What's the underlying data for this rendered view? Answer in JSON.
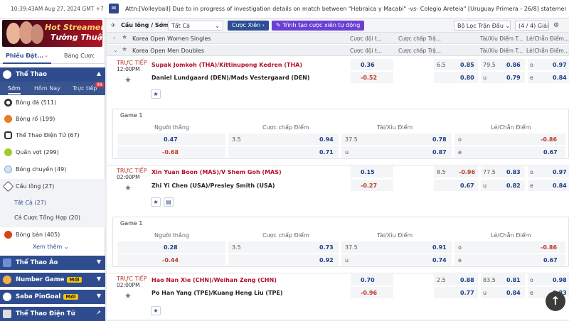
{
  "topbar": {
    "time": "10:39:43AM Aug 27, 2024 GMT +7",
    "ticker": "Attn:[Volleyball] Due to in progress of investigation details on match between \"Hebraica y Macabi\" -vs- Colegio Areteia\" [Uruguay Primera - 26/8] statement will be mov"
  },
  "sidebar": {
    "banner": {
      "line1": "Hot Streamer",
      "line2": "Tướng Thuật"
    },
    "tabs": [
      "Phiếu Đặt...",
      "Bảng Cược"
    ],
    "sports_header": "Thể Thao",
    "subtabs": [
      "Sớm",
      "Hôm Nay",
      "Trực tiếp"
    ],
    "live_count": "98",
    "sports": [
      {
        "label": "Bóng đá",
        "count": "(511)"
      },
      {
        "label": "Bóng rổ",
        "count": "(199)"
      },
      {
        "label": "Thể Thao Điện Tử",
        "count": "(67)"
      },
      {
        "label": "Quần vợt",
        "count": "(299)"
      },
      {
        "label": "Bóng chuyền",
        "count": "(49)"
      },
      {
        "label": "Cầu lông",
        "count": "(27)"
      }
    ],
    "sub_items": [
      {
        "label": "Tất Cả",
        "count": "(27)"
      },
      {
        "label": "Cá Cược Tổng Hợp",
        "count": "(20)"
      }
    ],
    "sport_table_tennis": {
      "label": "Bóng bàn",
      "count": "(405)"
    },
    "more": "Xem thêm",
    "virtual": "Thể Thao Ảo",
    "number_game": "Number Game",
    "pingoal": "Saba PinGoal",
    "new_badge": "Mới",
    "esports": "Thể Thao Điện Tử"
  },
  "filter": {
    "title": "Cầu lông / Sớm",
    "select_all": "Tất Cả",
    "parlay": "Cược Xiên",
    "creator": "Trình tạo cược xiên tự động",
    "match_filter": "Bộ Lọc Trận Đấu",
    "count": "(4 / 4) Giải"
  },
  "leagues": [
    {
      "name": "Korea Open Women Singles",
      "cols": [
        "Cược đội t...",
        "Cược chấp Trậ...",
        "Tài/Xỉu Điểm T...",
        "Lẻ/Chẵn Điểm..."
      ]
    },
    {
      "name": "Korea Open Men Doubles",
      "cols": [
        "Cược đội t...",
        "Cược chấp Trậ...",
        "Tài/Xỉu Điểm T...",
        "Lẻ/Chẵn Điểm..."
      ]
    }
  ],
  "live_label": "TRỰC TIẾP",
  "game_label": "Game 1",
  "game_cols": [
    "Người thắng",
    "Cược chấp Điểm",
    "Tài/Xỉu Điểm",
    "Lẻ/Chẵn Điểm"
  ],
  "matches": [
    {
      "time": "12:00PM",
      "home": "Supak Jomkoh (THA)/Kittinupong Kedren (THA)",
      "away": "Daniel Lundgaard (DEN)/Mads Vestergaard (DEN)",
      "ml": [
        "0.36",
        "-0.52"
      ],
      "hdp": [
        "6.5",
        "0.85",
        "",
        "0.80"
      ],
      "ou": [
        "79.5",
        "0.86",
        "u",
        "0.79"
      ],
      "oe": [
        "o",
        "0.97",
        "e",
        "0.84"
      ],
      "game": {
        "ml": [
          "0.47",
          "-0.68"
        ],
        "hdp": [
          "3.5",
          "0.94",
          "",
          "0.71"
        ],
        "ou": [
          "37.5",
          "0.78",
          "u",
          "0.87"
        ],
        "oe": [
          "o",
          "-0.86",
          "e",
          "0.67"
        ]
      }
    },
    {
      "time": "02:00PM",
      "home": "Xin Yuan Boon (MAS)/V Shem Goh (MAS)",
      "away": "Zhi Yi Chen (USA)/Presley Smith (USA)",
      "ml": [
        "0.15",
        "-0.27"
      ],
      "hdp": [
        "8.5",
        "-0.96",
        "",
        "0.67"
      ],
      "ou": [
        "77.5",
        "0.83",
        "u",
        "0.82"
      ],
      "oe": [
        "o",
        "0.97",
        "e",
        "0.84"
      ],
      "game": {
        "ml": [
          "0.28",
          "-0.44"
        ],
        "hdp": [
          "3.5",
          "0.73",
          "",
          "0.92"
        ],
        "ou": [
          "37.5",
          "0.91",
          "u",
          "0.74"
        ],
        "oe": [
          "o",
          "-0.86",
          "e",
          "0.67"
        ]
      }
    },
    {
      "time": "02:00PM",
      "home": "Hao Nan Xie (CHN)/Weihan Zeng (CHN)",
      "away": "Po Han Yang (TPE)/Kuang Heng Liu (TPE)",
      "ml": [
        "0.70",
        "-0.96"
      ],
      "hdp": [
        "2.5",
        "0.88",
        "",
        "0.77"
      ],
      "ou": [
        "83.5",
        "0.81",
        "u",
        "0.84"
      ],
      "oe": [
        "o",
        "0.98",
        "e",
        "0.83"
      ]
    }
  ],
  "colors": {
    "navy": "#2f4c8f",
    "red": "#b2102b",
    "purple": "#6b3fd3"
  }
}
